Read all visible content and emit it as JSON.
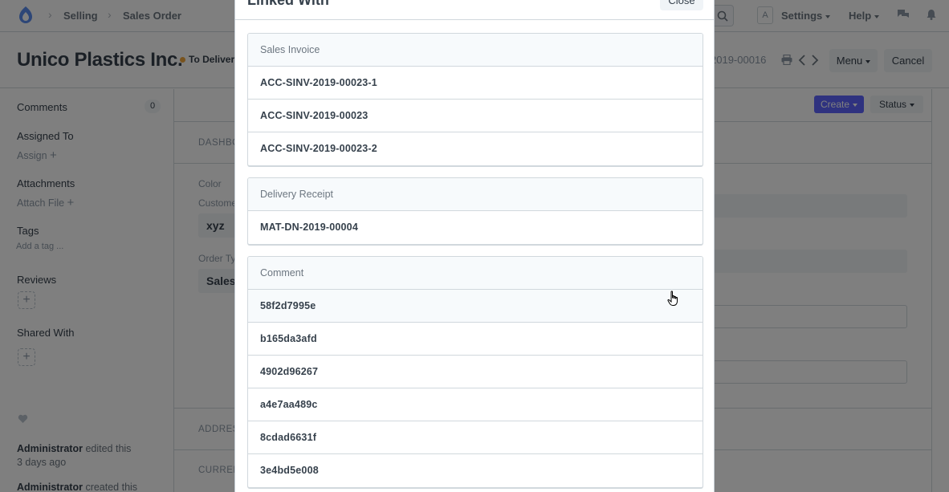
{
  "navbar": {
    "breadcrumbs": [
      "Selling",
      "Sales Order"
    ],
    "avatar_letter": "A",
    "settings_label": "Settings",
    "help_label": "Help"
  },
  "page": {
    "title": "Unico Plastics Inc.",
    "status": "To Deliver",
    "doc_number_fragment": "2019-00016",
    "menu_label": "Menu",
    "cancel_label": "Cancel"
  },
  "sidebar": {
    "comments_label": "Comments",
    "comments_count": "0",
    "assigned_to_label": "Assigned To",
    "assign_label": "Assign",
    "attachments_label": "Attachments",
    "attach_file_label": "Attach File",
    "tags_label": "Tags",
    "add_tag_label": "Add a tag ...",
    "reviews_label": "Reviews",
    "shared_with_label": "Shared With",
    "activity": [
      {
        "user": "Administrator",
        "action": "edited this",
        "time": "3 days ago"
      },
      {
        "user": "Administrator",
        "action": "created this",
        "time": ""
      }
    ]
  },
  "main": {
    "create_label": "Create",
    "status_label": "Status",
    "dashboard_fragment": "DASHBO",
    "color_label": "Color",
    "customer_label_fragment": "Custome",
    "customer_value_fragment": "xyz",
    "order_type_label_fragment": "Order Ty",
    "order_type_value_fragment": "Sales",
    "address_fragment": "ADDRES",
    "currency_fragment": "CURREN"
  },
  "modal": {
    "title": "Linked With",
    "close_label": "Close",
    "groups": [
      {
        "name": "Sales Invoice",
        "items": [
          "ACC-SINV-2019-00023-1",
          "ACC-SINV-2019-00023",
          "ACC-SINV-2019-00023-2"
        ]
      },
      {
        "name": "Delivery Receipt",
        "items": [
          "MAT-DN-2019-00004"
        ]
      },
      {
        "name": "Comment",
        "items": [
          "58f2d7995e",
          "b165da3afd",
          "4902d96267",
          "a4e7aa489c",
          "8cdad6631f",
          "3e4bd5e008"
        ]
      }
    ]
  },
  "colors": {
    "primary": "#5e64ff",
    "status_orange": "#f0a73d",
    "backdrop": "rgba(0,0,0,0.5)"
  }
}
